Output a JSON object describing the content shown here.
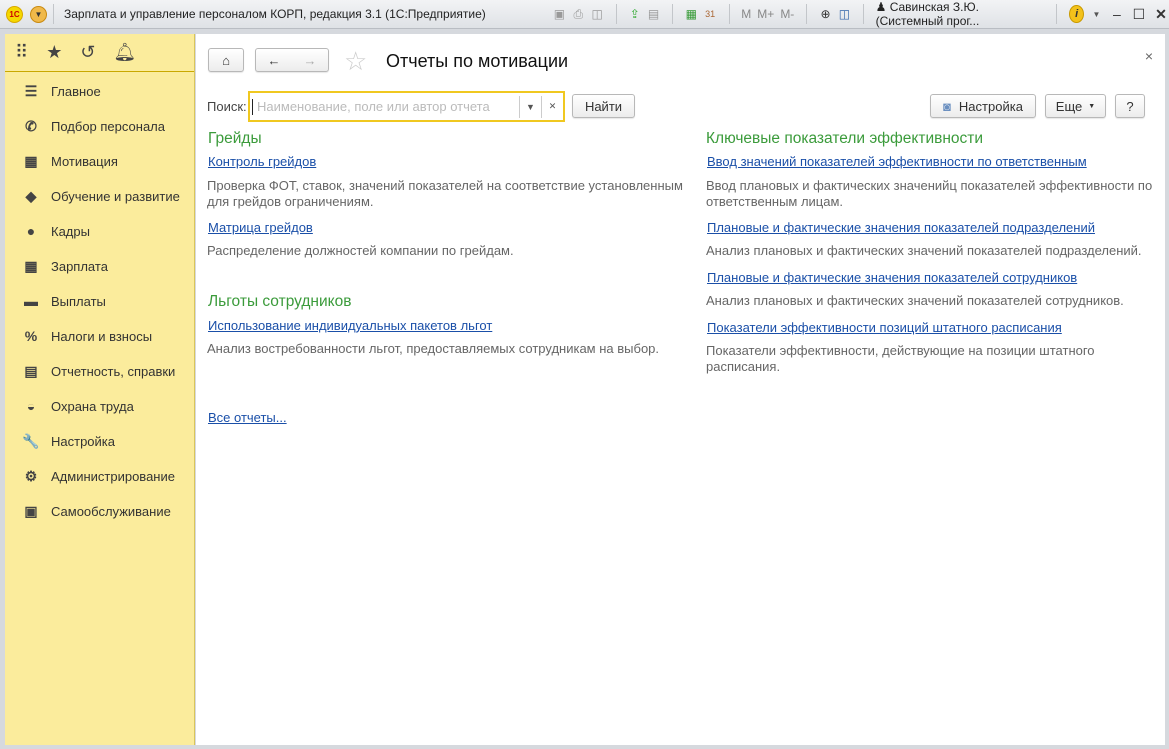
{
  "window": {
    "title": "Зарплата и управление персоналом КОРП, редакция 3.1  (1С:Предприятие)",
    "logo": "1С",
    "user": "Савинская З.Ю. (Системный прог...",
    "toolbar": [
      "M",
      "M+",
      "M-"
    ]
  },
  "sidebar": {
    "items": [
      {
        "icon": "menu-lines-icon",
        "glyph": "☰",
        "label": "Главное"
      },
      {
        "icon": "phone-icon",
        "glyph": "✆",
        "label": "Подбор персонала"
      },
      {
        "icon": "gift-icon",
        "glyph": "▦",
        "label": "Мотивация"
      },
      {
        "icon": "graduation-cap-icon",
        "glyph": "◆",
        "label": "Обучение и развитие"
      },
      {
        "icon": "people-icon",
        "glyph": "●",
        "label": "Кадры"
      },
      {
        "icon": "calculator-icon",
        "glyph": "▦",
        "label": "Зарплата"
      },
      {
        "icon": "card-icon",
        "glyph": "▬",
        "label": "Выплаты"
      },
      {
        "icon": "percent-icon",
        "glyph": "%",
        "label": "Налоги и взносы"
      },
      {
        "icon": "documents-icon",
        "glyph": "▤",
        "label": "Отчетность, справки"
      },
      {
        "icon": "helmet-icon",
        "glyph": "◒",
        "label": "Охрана труда"
      },
      {
        "icon": "wrench-icon",
        "glyph": "🔧",
        "label": "Настройка"
      },
      {
        "icon": "gear-icon",
        "glyph": "⚙",
        "label": "Администрирование"
      },
      {
        "icon": "id-card-icon",
        "glyph": "▣",
        "label": "Самообслуживание"
      }
    ]
  },
  "page": {
    "title": "Отчеты по мотивации",
    "search_label": "Поиск:",
    "search_placeholder": "Наименование, поле или автор отчета",
    "search_value": "",
    "find": "Найти",
    "settings": "Настройка",
    "more": "Еще",
    "help": "?",
    "all_reports": "Все отчеты..."
  },
  "left": [
    {
      "heading": "Грейды",
      "reports": [
        {
          "link": "Контроль грейдов",
          "desc": "Проверка ФОТ, ставок, значений показателей на соответствие установленным для грейдов ограничениям."
        },
        {
          "link": "Матрица грейдов",
          "desc": "Распределение должностей компании по грейдам."
        }
      ]
    },
    {
      "heading": "Льготы сотрудников",
      "reports": [
        {
          "link": "Использование индивидуальных пакетов льгот",
          "desc": "Анализ востребованности льгот, предоставляемых сотрудникам на выбор."
        }
      ]
    }
  ],
  "right": {
    "heading": "Ключевые показатели эффективности",
    "reports": [
      {
        "link": "Ввод значений показателей эффективности по ответственным",
        "desc": "Ввод плановых и фактических значенийц показателей эффективности по ответственным лицам."
      },
      {
        "link": "Плановые и фактические значения показателей подразделений",
        "desc": "Анализ плановых и фактических значений показателей подразделений."
      },
      {
        "link": "Плановые и фактические значения показателей сотрудников",
        "desc": "Анализ плановых и фактических значений показателей сотрудников."
      },
      {
        "link": "Показатели эффективности позиций штатного расписания",
        "desc": "Показатели эффективности, действующие на позиции штатного расписания."
      }
    ]
  }
}
